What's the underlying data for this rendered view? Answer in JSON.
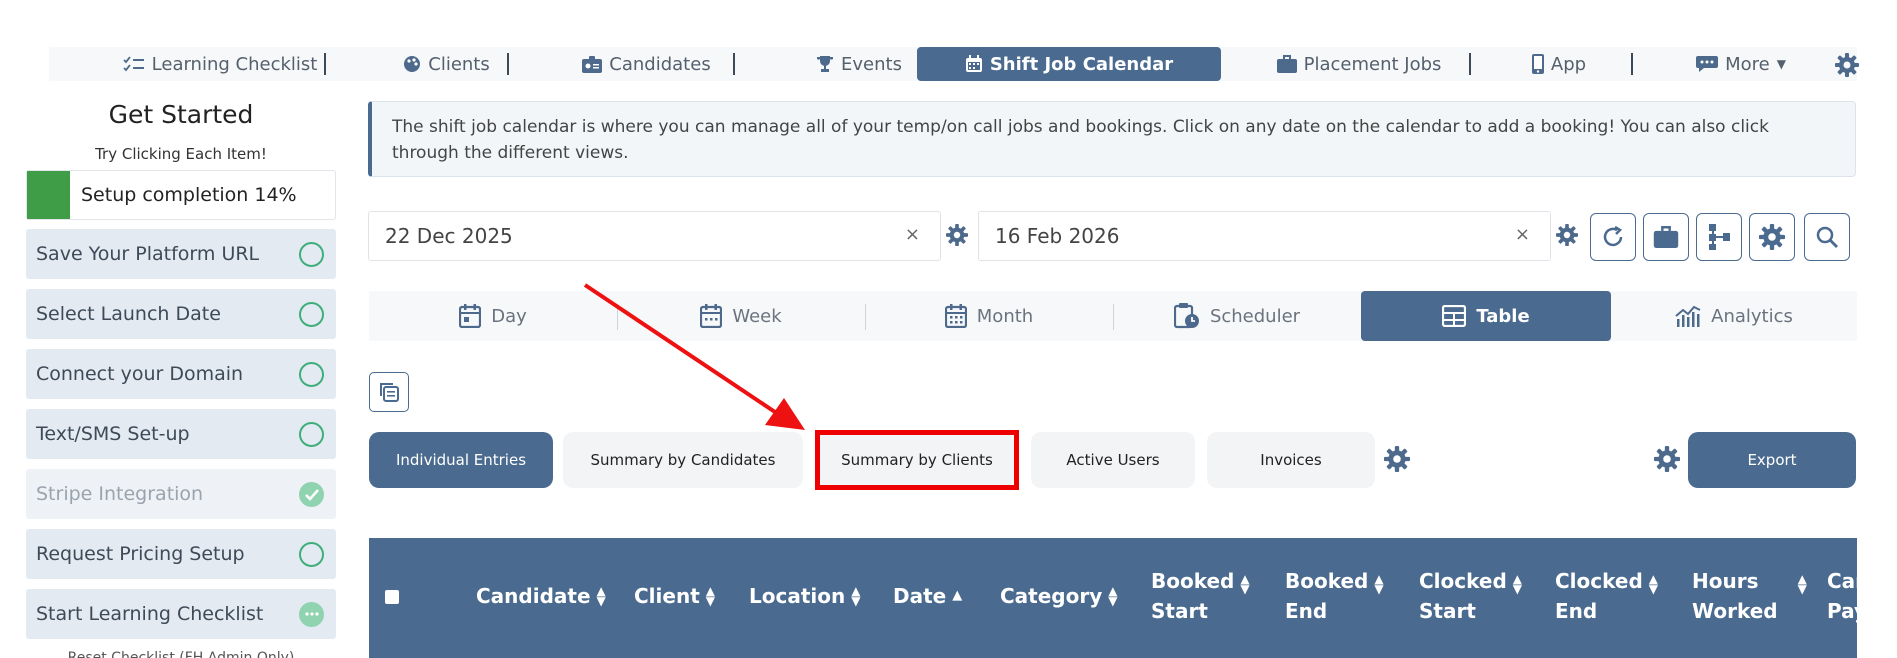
{
  "topnav": {
    "items": [
      {
        "label": "Learning Checklist",
        "icon": "checklist-icon"
      },
      {
        "label": "Clients",
        "icon": "palette-icon"
      },
      {
        "label": "Candidates",
        "icon": "id-card-icon"
      },
      {
        "label": "Events",
        "icon": "trophy-icon"
      },
      {
        "label": "Shift Job Calendar",
        "icon": "calendar-icon",
        "active": true
      },
      {
        "label": "Placement Jobs",
        "icon": "briefcase-icon"
      },
      {
        "label": "App",
        "icon": "mobile-icon"
      },
      {
        "label": "More",
        "icon": "chat-icon"
      }
    ]
  },
  "sidebar": {
    "title": "Get Started",
    "subtitle": "Try Clicking Each Item!",
    "progress_label": "Setup completion 14%",
    "progress_value": 14,
    "items": [
      {
        "label": "Save Your Platform URL",
        "status": "open"
      },
      {
        "label": "Select Launch Date",
        "status": "open"
      },
      {
        "label": "Connect your Domain",
        "status": "open"
      },
      {
        "label": "Text/SMS Set-up",
        "status": "open"
      },
      {
        "label": "Stripe Integration",
        "status": "done"
      },
      {
        "label": "Request Pricing Setup",
        "status": "open"
      },
      {
        "label": "Start Learning Checklist",
        "status": "more"
      }
    ],
    "reset_link": "Reset Checklist (FH Admin Only)"
  },
  "info_banner": "The shift job calendar is where you can manage all of your temp/on call jobs and bookings. Click on any date on the calendar to add a booking! You can also click through the different views.",
  "filters": {
    "start_date": "22 Dec 2025",
    "end_date": "16 Feb 2026",
    "clear_symbol": "×"
  },
  "view_tabs": [
    {
      "label": "Day",
      "icon": "calendar-day-icon"
    },
    {
      "label": "Week",
      "icon": "calendar-week-icon"
    },
    {
      "label": "Month",
      "icon": "calendar-month-icon"
    },
    {
      "label": "Scheduler",
      "icon": "clipboard-clock-icon"
    },
    {
      "label": "Table",
      "icon": "table-icon",
      "active": true
    },
    {
      "label": "Analytics",
      "icon": "analytics-icon"
    }
  ],
  "report_tabs": [
    {
      "label": "Individual Entries",
      "active": true
    },
    {
      "label": "Summary by Candidates"
    },
    {
      "label": "Summary by Clients"
    },
    {
      "label": "Active Users"
    },
    {
      "label": "Invoices"
    }
  ],
  "export_label": "Export",
  "table": {
    "columns": [
      {
        "l1": "Candidate",
        "l2": ""
      },
      {
        "l1": "Client",
        "l2": ""
      },
      {
        "l1": "Location",
        "l2": ""
      },
      {
        "l1": "Date",
        "l2": ""
      },
      {
        "l1": "Category",
        "l2": ""
      },
      {
        "l1": "Booked",
        "l2": "Start"
      },
      {
        "l1": "Booked",
        "l2": "End"
      },
      {
        "l1": "Clocked",
        "l2": "Start"
      },
      {
        "l1": "Clocked",
        "l2": "End"
      },
      {
        "l1": "Hours",
        "l2": "Worked"
      },
      {
        "l1": "Can",
        "l2": "Pay"
      }
    ]
  },
  "colors": {
    "primary": "#4a6b8f",
    "success": "#3f9d47",
    "highlight": "#ee0000"
  }
}
